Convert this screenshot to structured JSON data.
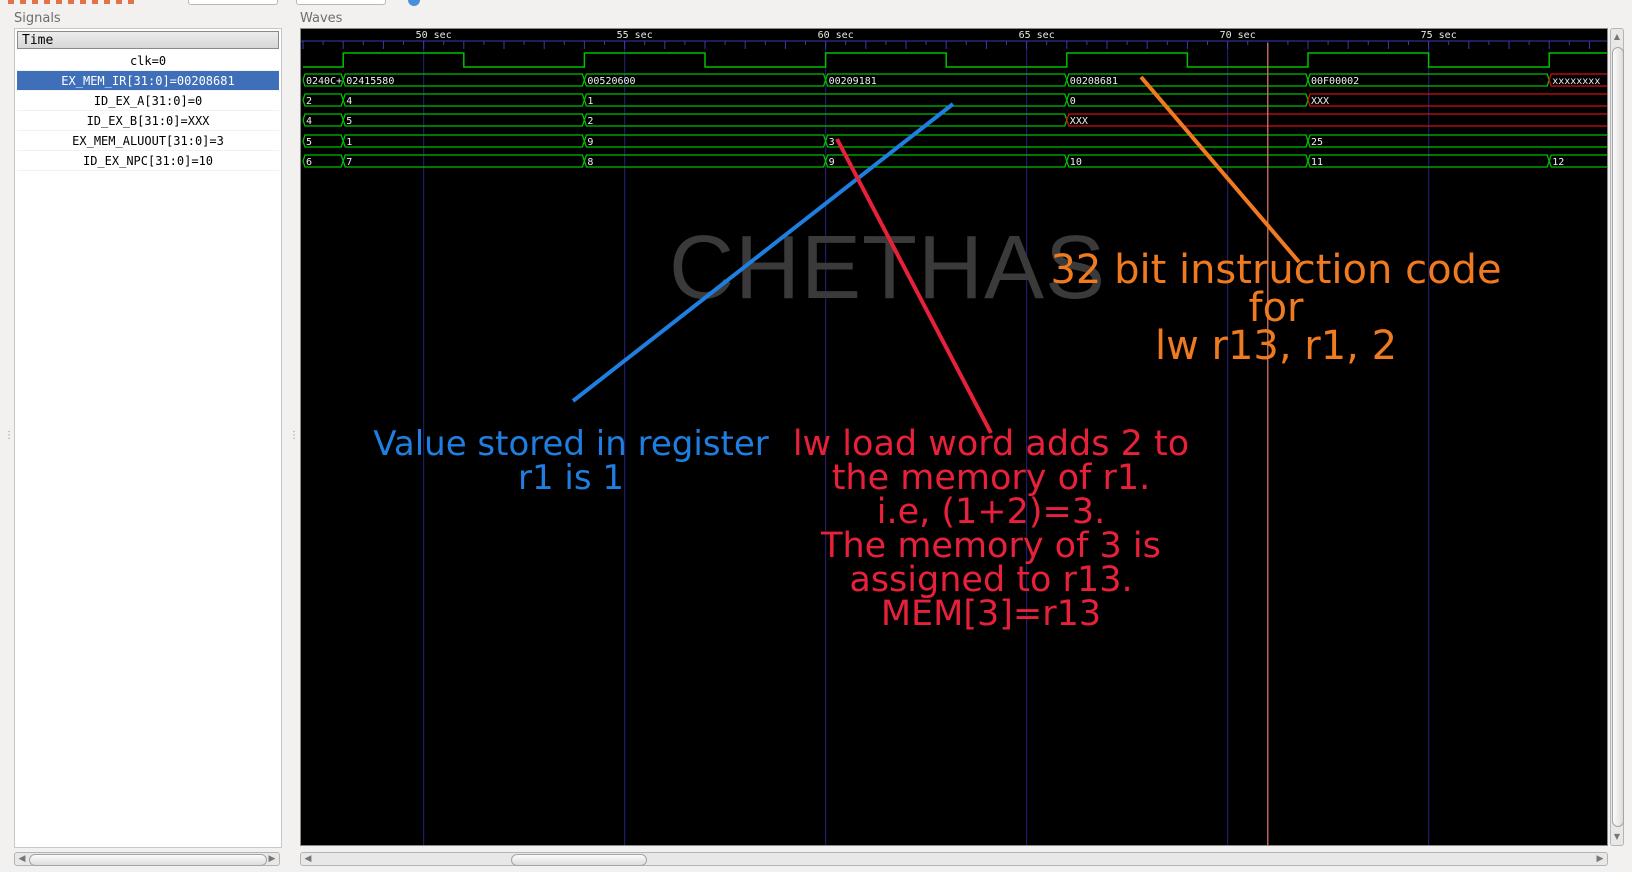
{
  "panels": {
    "signals_label": "Signals",
    "waves_label": "Waves"
  },
  "signals": {
    "header": "Time",
    "rows": [
      {
        "label": "clk=0",
        "selected": false
      },
      {
        "label": "EX_MEM_IR[31:0]=00208681",
        "selected": true
      },
      {
        "label": "ID_EX_A[31:0]=0",
        "selected": false
      },
      {
        "label": "ID_EX_B[31:0]=XXX",
        "selected": false
      },
      {
        "label": "EX_MEM_ALUOUT[31:0]=3",
        "selected": false
      },
      {
        "label": "ID_EX_NPC[31:0]=10",
        "selected": false
      }
    ]
  },
  "waves": {
    "time_unit": "sec",
    "ticks": [
      "50 sec",
      "55 sec",
      "60 sec",
      "65 sec",
      "70 sec",
      "75 sec"
    ],
    "buses": [
      {
        "name": "EX_MEM_IR",
        "segments": [
          {
            "t0": 47,
            "t1": 48,
            "value": "0240C+"
          },
          {
            "t0": 48,
            "t1": 54,
            "value": "02415580"
          },
          {
            "t0": 54,
            "t1": 60,
            "value": "00520600"
          },
          {
            "t0": 60,
            "t1": 66,
            "value": "00209181"
          },
          {
            "t0": 66,
            "t1": 72,
            "value": "00208681"
          },
          {
            "t0": 72,
            "t1": 78,
            "value": "00F00002"
          },
          {
            "t0": 78,
            "t1": 80,
            "value": "xxxxxxxx",
            "unknown": true
          }
        ]
      },
      {
        "name": "ID_EX_A",
        "segments": [
          {
            "t0": 47,
            "t1": 48,
            "value": "2"
          },
          {
            "t0": 48,
            "t1": 54,
            "value": "4"
          },
          {
            "t0": 54,
            "t1": 66,
            "value": "1"
          },
          {
            "t0": 66,
            "t1": 72,
            "value": "0"
          },
          {
            "t0": 72,
            "t1": 80,
            "value": "XXX",
            "unknown": true
          }
        ]
      },
      {
        "name": "ID_EX_B",
        "segments": [
          {
            "t0": 47,
            "t1": 48,
            "value": "4"
          },
          {
            "t0": 48,
            "t1": 54,
            "value": "5"
          },
          {
            "t0": 54,
            "t1": 66,
            "value": "2"
          },
          {
            "t0": 66,
            "t1": 80,
            "value": "XXX",
            "unknown": true
          }
        ]
      },
      {
        "name": "EX_MEM_ALUOUT",
        "segments": [
          {
            "t0": 47,
            "t1": 48,
            "value": "5"
          },
          {
            "t0": 48,
            "t1": 54,
            "value": "1"
          },
          {
            "t0": 54,
            "t1": 60,
            "value": "9"
          },
          {
            "t0": 60,
            "t1": 72,
            "value": "3"
          },
          {
            "t0": 72,
            "t1": 80,
            "value": "25"
          }
        ]
      },
      {
        "name": "ID_EX_NPC",
        "segments": [
          {
            "t0": 47,
            "t1": 48,
            "value": "6"
          },
          {
            "t0": 48,
            "t1": 54,
            "value": "7"
          },
          {
            "t0": 54,
            "t1": 60,
            "value": "8"
          },
          {
            "t0": 60,
            "t1": 66,
            "value": "9"
          },
          {
            "t0": 66,
            "t1": 72,
            "value": "10"
          },
          {
            "t0": 72,
            "t1": 78,
            "value": "11"
          },
          {
            "t0": 78,
            "t1": 80,
            "value": "12"
          }
        ]
      }
    ]
  },
  "watermark": "CHETHAS",
  "annotations": {
    "blue": {
      "lines": [
        "Value stored in register",
        "r1 is 1"
      ],
      "color": "#1f7fe0"
    },
    "red": {
      "lines": [
        "lw load word adds 2 to",
        "the memory of r1.",
        "i.e, (1+2)=3.",
        "The memory of 3 is",
        "assigned to r13.",
        "MEM[3]=r13"
      ],
      "color": "#e8213b"
    },
    "orange": {
      "lines": [
        "32 bit instruction code",
        "for",
        "lw r13, r1, 2"
      ],
      "color": "#f07a20"
    }
  },
  "colors": {
    "wave_bg": "#000000",
    "wave_green": "#00c000",
    "wave_unknown": "#d01010",
    "grid_blue": "#1c1c6a",
    "cursor": "#e08070",
    "selection": "#3f6fb8"
  }
}
